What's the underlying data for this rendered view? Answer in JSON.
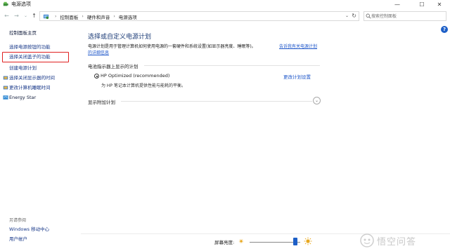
{
  "window": {
    "title": "电源选项",
    "minimize": "—",
    "maximize": "☐",
    "close": "✕"
  },
  "addressbar": {
    "back": "←",
    "forward": "→",
    "history": "⌄",
    "up": "↑",
    "breadcrumbs": [
      "控制面板",
      "硬件和声音",
      "电源选项"
    ],
    "separator": "›",
    "dropdown": "⌄",
    "refresh": "↻",
    "search_placeholder": "搜索控制面板"
  },
  "sidebar": {
    "items": [
      {
        "label": "控制面板主页"
      },
      {
        "label": "选择电源按钮的功能"
      },
      {
        "label": "选择关闭盖子的功能"
      },
      {
        "label": "创建电源计划"
      },
      {
        "label": "选择关闭显示器的时间"
      },
      {
        "label": "更改计算机睡眠时间"
      },
      {
        "label": "Energy Star"
      }
    ],
    "see_also": "另请参阅",
    "see_also_items": [
      {
        "label": "Windows 移动中心"
      },
      {
        "label": "用户帐户"
      }
    ]
  },
  "main": {
    "title": "选择或自定义电源计划",
    "description": "电源计划是用于管理计算机如何使用电源的一套硬件和系统设置(如显示器亮度、睡眠等)。",
    "desc_link_part1": "告诉我有关电源计划",
    "desc_link_part2": "的详细信息",
    "battery_section": "电池指示器上显示的计划",
    "plan_name": "HP Optimized (recommended)",
    "plan_settings_link": "更改计划设置",
    "plan_description": "为 HP 笔记本计算机提供性能与能耗的平衡。",
    "additional_plans": "显示附加计划",
    "expand_icon": "⌄",
    "help": "?"
  },
  "footer": {
    "brightness_label": "屏幕亮度:",
    "brightness_level": 0.9
  },
  "watermark": {
    "text": "悟空问答"
  },
  "colors": {
    "link": "#1c55c9",
    "title_blue": "#1e3d78",
    "highlight_red": "#e02020",
    "accent": "#1d5fc7"
  }
}
